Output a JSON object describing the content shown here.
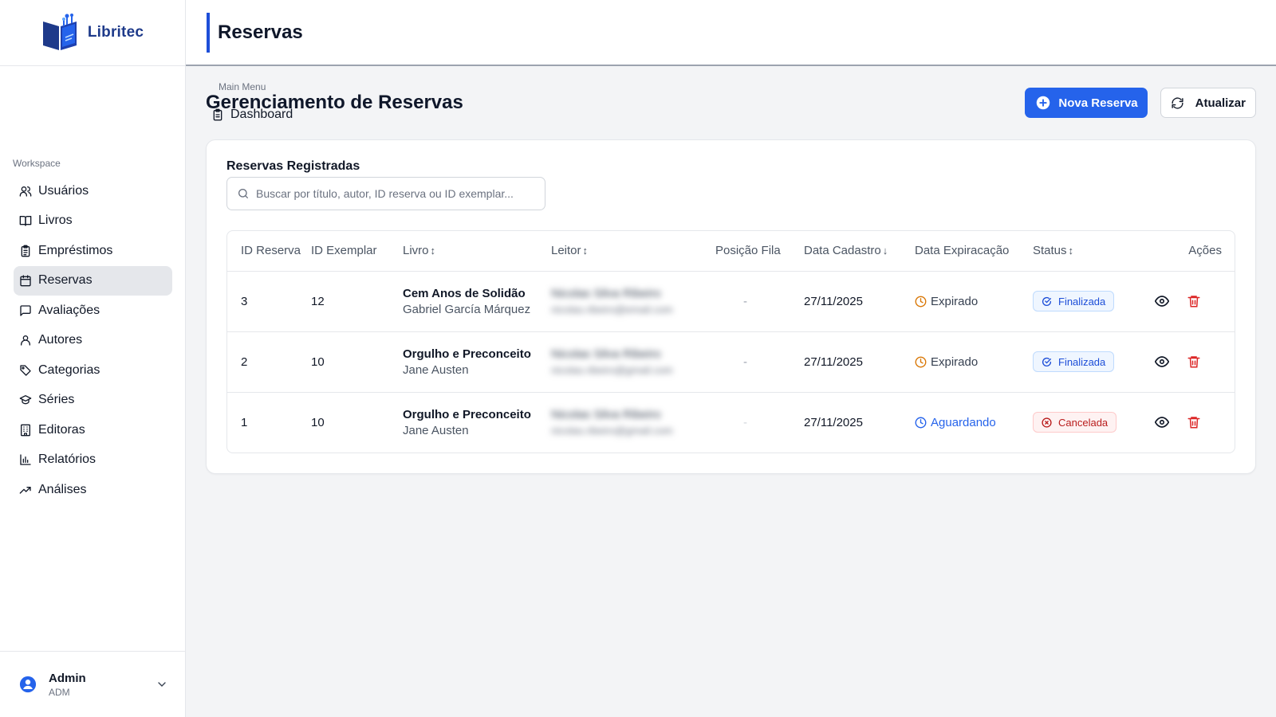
{
  "app": {
    "name": "Libritec"
  },
  "colors": {
    "accent": "#2563eb",
    "brand": "#1e3a8a",
    "expired": "#d97706",
    "waiting": "#2563eb",
    "finalizada": "#1d4ed8",
    "cancelada": "#b91c1c",
    "delete": "#dc2626"
  },
  "sidebar": {
    "main_label": "Main Menu",
    "main_items": [
      {
        "label": "Dashboard",
        "icon": "clipboard-icon"
      }
    ],
    "workspace_label": "Workspace",
    "workspace_items": [
      {
        "label": "Usuários",
        "icon": "users-icon"
      },
      {
        "label": "Livros",
        "icon": "book-open-icon"
      },
      {
        "label": "Empréstimos",
        "icon": "clipboard-list-icon"
      },
      {
        "label": "Reservas",
        "icon": "calendar-icon",
        "active": true
      },
      {
        "label": "Avaliações",
        "icon": "message-square-icon"
      },
      {
        "label": "Autores",
        "icon": "user-icon"
      },
      {
        "label": "Categorias",
        "icon": "tag-icon"
      },
      {
        "label": "Séries",
        "icon": "graduation-cap-icon"
      },
      {
        "label": "Editoras",
        "icon": "building-icon"
      },
      {
        "label": "Relatórios",
        "icon": "bar-chart-icon"
      },
      {
        "label": "Análises",
        "icon": "trending-up-icon"
      }
    ],
    "user": {
      "name": "Admin",
      "role": "ADM"
    }
  },
  "topbar": {
    "title": "Reservas"
  },
  "page": {
    "title": "Gerenciamento de Reservas",
    "new_button": "Nova Reserva",
    "refresh_button": "Atualizar"
  },
  "card": {
    "title": "Reservas Registradas",
    "search_placeholder": "Buscar por título, autor, ID reserva ou ID exemplar..."
  },
  "table": {
    "columns": [
      {
        "label": "ID Reserva",
        "sort": ""
      },
      {
        "label": "ID Exemplar",
        "sort": ""
      },
      {
        "label": "Livro",
        "sort": "↕"
      },
      {
        "label": "Leitor",
        "sort": "↕"
      },
      {
        "label": "Posição Fila",
        "sort": ""
      },
      {
        "label": "Data Cadastro",
        "sort": "↓"
      },
      {
        "label": "Data Expiracação",
        "sort": ""
      },
      {
        "label": "Status",
        "sort": "↕"
      },
      {
        "label": "Ações",
        "sort": ""
      }
    ],
    "rows": [
      {
        "id": "3",
        "exemplar": "12",
        "book": "Cem Anos de Solidão",
        "author": "Gabriel García Márquez",
        "reader_name": "Nicolas Silva Ribeiro",
        "reader_email": "nicolas.ribeiro@email.com",
        "queue": "-",
        "date": "27/11/2025",
        "expiration": "Expirado",
        "expiration_state": "expired",
        "status": "Finalizada",
        "status_state": "finalizada"
      },
      {
        "id": "2",
        "exemplar": "10",
        "book": "Orgulho e Preconceito",
        "author": "Jane Austen",
        "reader_name": "Nicolas Silva Ribeiro",
        "reader_email": "nicolas.ribeiro@gmail.com",
        "queue": "-",
        "date": "27/11/2025",
        "expiration": "Expirado",
        "expiration_state": "expired",
        "status": "Finalizada",
        "status_state": "finalizada"
      },
      {
        "id": "1",
        "exemplar": "10",
        "book": "Orgulho e Preconceito",
        "author": "Jane Austen",
        "reader_name": "Nicolas Silva Ribeiro",
        "reader_email": "nicolas.ribeiro@gmail.com",
        "queue": "-",
        "date": "27/11/2025",
        "expiration": "Aguardando",
        "expiration_state": "waiting",
        "status": "Cancelada",
        "status_state": "cancelada"
      }
    ]
  }
}
